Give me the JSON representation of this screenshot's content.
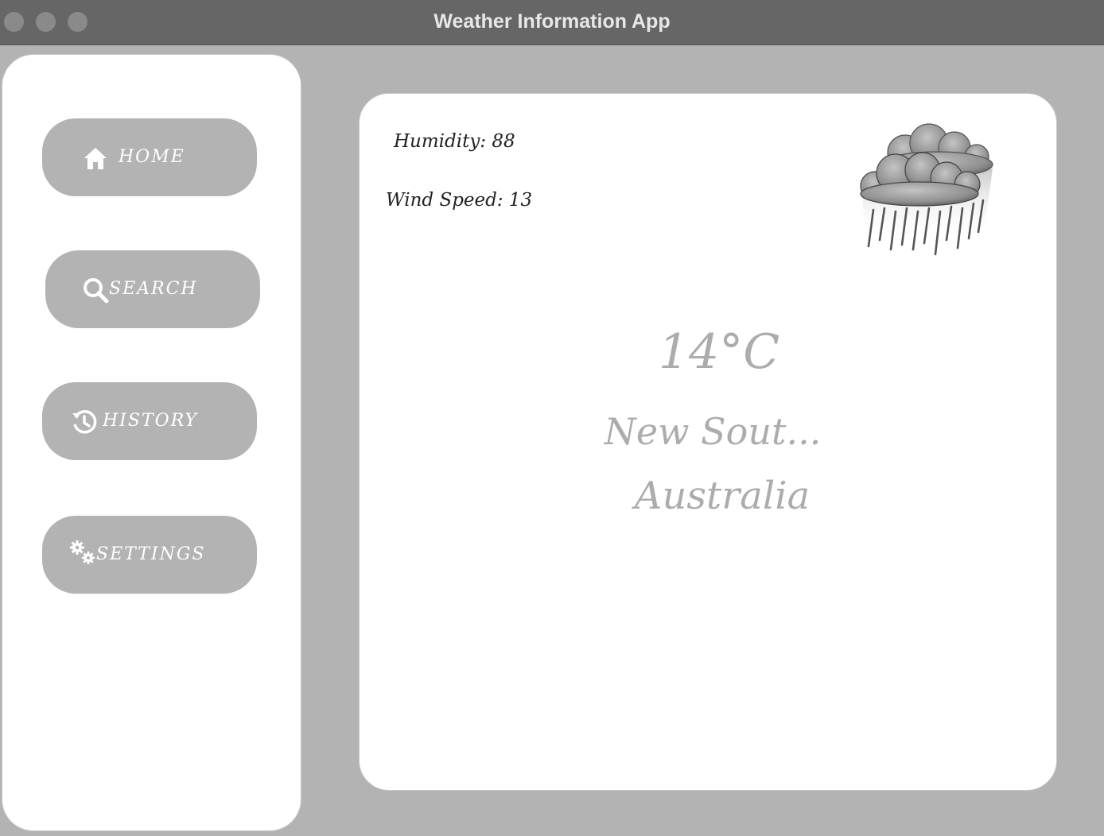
{
  "window": {
    "title": "Weather Information App",
    "controls": [
      "close",
      "minimize",
      "zoom"
    ]
  },
  "sidebar": {
    "items": [
      {
        "label": "HOME",
        "icon": "home-icon"
      },
      {
        "label": "SEARCH",
        "icon": "search-icon"
      },
      {
        "label": "HISTORY",
        "icon": "history-icon"
      },
      {
        "label": "SETTINGS",
        "icon": "gears-icon"
      }
    ]
  },
  "weather": {
    "humidity": "Humidity: 88",
    "wind_speed": "Wind Speed: 13",
    "temperature": "14°C",
    "city": "New Sout...",
    "country": "Australia",
    "icon": "rain-cloud-icon"
  },
  "colors": {
    "background": "#b3b3b3",
    "titlebar": "#666666",
    "panel": "#ffffff",
    "button": "#b3b3b3",
    "muted_text": "#acacac"
  }
}
